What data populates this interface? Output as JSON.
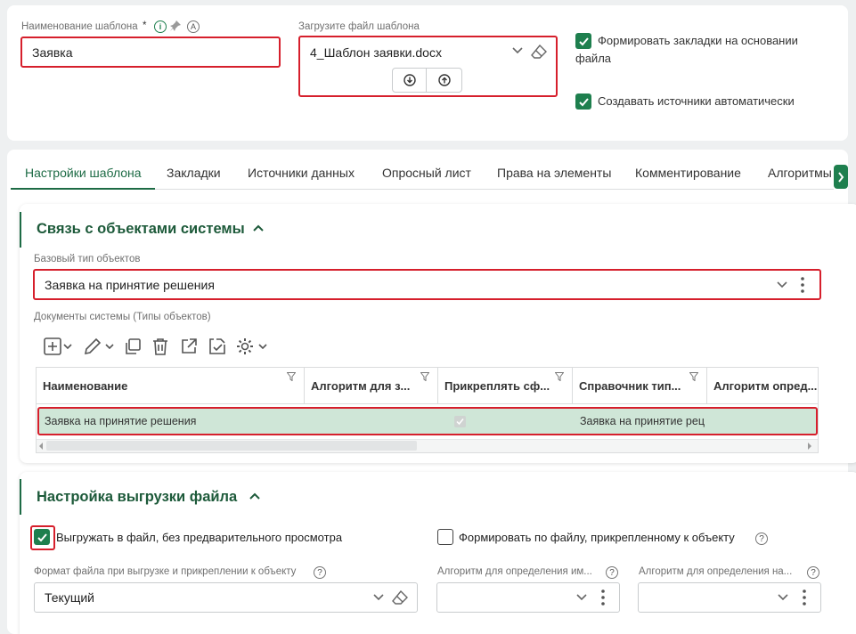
{
  "template": {
    "name_label": "Наименование шаблона",
    "name_required": "*",
    "name_value": "Заявка",
    "file_label": "Загрузите файл шаблона",
    "file_value": "4_Шаблон заявки.docx",
    "bookmarks_checkbox_line1": "Формировать закладки на основании",
    "bookmarks_checkbox_line2": "файла",
    "sources_checkbox": "Создавать источники автоматически"
  },
  "tabs": [
    {
      "label": "Настройки шаблона",
      "active": true
    },
    {
      "label": "Закладки"
    },
    {
      "label": "Источники данных"
    },
    {
      "label": "Опросный лист"
    },
    {
      "label": "Права на элементы"
    },
    {
      "label": "Комментирование"
    },
    {
      "label": "Алгоритмы"
    }
  ],
  "relations": {
    "title": "Связь с объектами системы",
    "base_type_label": "Базовый тип объектов",
    "base_type_value": "Заявка на принятие решения",
    "docs_label": "Документы системы (Типы объектов)",
    "table": {
      "columns": [
        "Наименование",
        "Алгоритм для з...",
        "Прикреплять сф...",
        "Справочник тип...",
        "Алгоритм опред..."
      ],
      "rows": [
        {
          "name": "Заявка на принятие решения",
          "algorithm": "",
          "attach": true,
          "catalog": "Заявка на принятие рец",
          "algorithm2": ""
        }
      ]
    }
  },
  "export": {
    "title": "Настройка выгрузки файла",
    "export_checkbox": "Выгружать в файл, без предварительного просмотра",
    "form_by_file_checkbox": "Формировать по файлу, прикрепленному к объекту",
    "format_label": "Формат файла при выгрузке и прикреплении к объекту",
    "format_value": "Текущий",
    "algo_name_label": "Алгоритм для определения им...",
    "algo_name2_label": "Алгоритм для определения на..."
  },
  "colors": {
    "accent": "#1e7f4e",
    "highlight": "#d61f2c",
    "selected_row": "#cfe6d7"
  }
}
